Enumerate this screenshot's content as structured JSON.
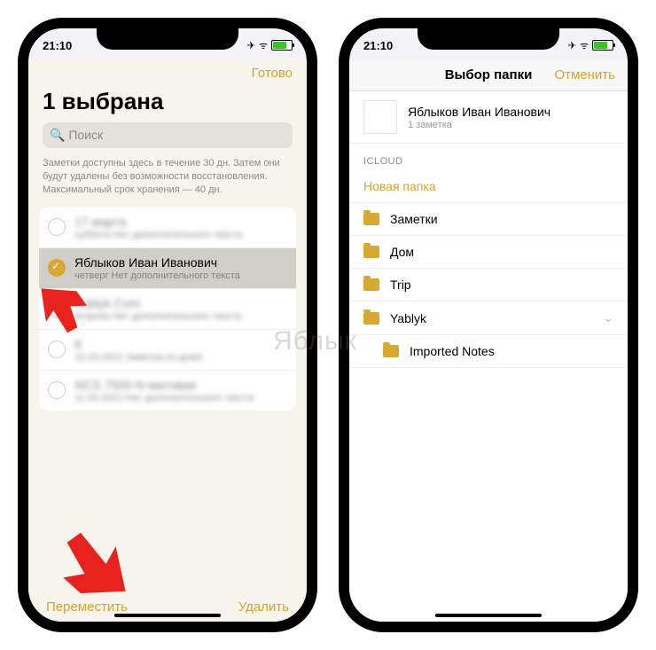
{
  "status": {
    "time": "21:10",
    "plane": "✈",
    "wifi": "ᯤ"
  },
  "p1": {
    "done": "Готово",
    "title": "1 выбрана",
    "search_placeholder": "Поиск",
    "info": "Заметки доступны здесь в течение 30 дн. Затем они будут удалены без возможности восстановления. Максимальный срок хранения — 40 дн.",
    "items": [
      {
        "t": "17 марта",
        "s": "суббота  Нет дополнительного текста"
      },
      {
        "t": "Яблыков Иван Иванович",
        "s": "четверг  Нет дополнительного текста"
      },
      {
        "t": "Yablyk.Com",
        "s": "вторник  Нет дополнительного текста"
      },
      {
        "t": "8",
        "s": "10.03.2021 Заметка из дома"
      },
      {
        "t": "NCS 7500-N матовая",
        "s": "11.03.2021 Нет дополнительного текста"
      }
    ],
    "move": "Переместить",
    "delete": "Удалить"
  },
  "p2": {
    "nav_title": "Выбор папки",
    "cancel": "Отменить",
    "note_title": "Яблыков Иван Иванович",
    "note_sub": "1 заметка",
    "section": "ICLOUD",
    "new_folder": "Новая папка",
    "folders": [
      "Заметки",
      "Дом",
      "Trip",
      "Yablyk",
      "Imported Notes"
    ]
  },
  "watermark": "Яблык"
}
